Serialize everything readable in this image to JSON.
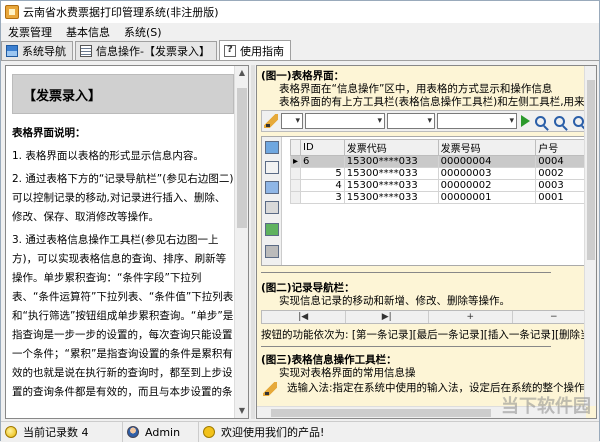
{
  "window": {
    "title": "云南省水费票据打印管理系统(非注册版)"
  },
  "menu": [
    "发票管理",
    "基本信息",
    "系统(S)"
  ],
  "tabs": [
    {
      "label": "系统导航",
      "icon": "nav-icon"
    },
    {
      "label": "信息操作-【发票录入】",
      "icon": "info-grid-icon"
    },
    {
      "label": "使用指南",
      "icon": "help-icon",
      "active": true
    }
  ],
  "left_doc": {
    "heading": "【发票录入】",
    "intro_title": "表格界面说明：",
    "paragraphs": [
      "1. 表格界面以表格的形式显示信息内容。",
      "2. 通过表格下方的“记录导航栏”(参见右边图二)可以控制记录的移动,对记录进行插入、删除、修改、保存、取消修改等操作。",
      "3. 通过表格信息操作工具栏(参见右边图一上方)，可以实现表格信息的查询、排序、刷新等操作。单步累积查询：“条件字段”下拉列表、“条件运算符”下拉列表、“条件值”下拉列表和“执行筛选”按钮组成单步累积查询。“单步”是指查询是一步一步的设置的，每次查询只能设置一个条件；“累积”是指查询设置的条件是累积有效的也就是说在执行新的查询时，都至到上步设置的查询条件都是有效的，而且与本步设置的条"
    ]
  },
  "right_doc": {
    "section1_title": "(图一)表格界面：",
    "section1_lines": [
      "表格界面在“信息操作”区中，用表格的方式显示和操作信息",
      "表格界面的有上方工具栏(表格信息操作工具栏)和左侧工具栏,用来实现信"
    ],
    "grid": {
      "columns": [
        "ID",
        "发票代码",
        "发票号码",
        "户号"
      ],
      "rows": [
        [
          "6",
          "15300****033",
          "00000004",
          "0004"
        ],
        [
          "5",
          "15300****033",
          "00000003",
          "0002"
        ],
        [
          "4",
          "15300****033",
          "00000002",
          "0003"
        ],
        [
          "3",
          "15300****033",
          "00000001",
          "0001"
        ]
      ]
    },
    "section2_title": "(图二)记录导航栏：",
    "section2_lines": [
      "实现信息记录的移动和新增、修改、删除等操作。"
    ],
    "nav_buttons": [
      "|◀",
      "▶|",
      "+",
      "−"
    ],
    "nav_desc": "按钮的功能依次为: [第一条记录][最后一条记录][插入一条记录][删除当前记录]",
    "section3_title": "(图三)表格信息操作工具栏：",
    "section3_lines": [
      "实现对表格界面的常用信息操",
      "选输入法:指定在系统中使用的输入法，设定后在系统的整个操作过程中"
    ]
  },
  "status": {
    "record_label": "当前记录数 4",
    "user": "Admin",
    "welcome": "欢迎使用我们的产品!"
  },
  "watermark": "当下软件园"
}
